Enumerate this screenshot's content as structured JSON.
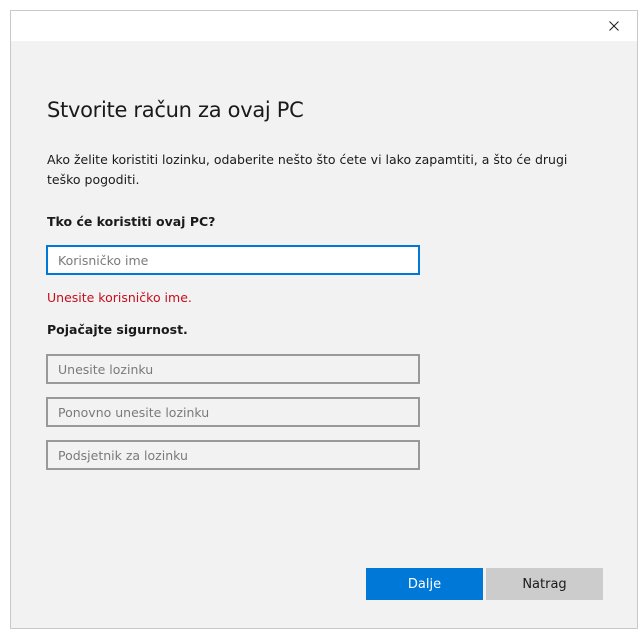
{
  "dialog": {
    "heading": "Stvorite račun za ovaj PC",
    "description": "Ako želite koristiti lozinku, odaberite nešto što ćete vi lako zapamtiti, a što će drugi teško pogoditi.",
    "close_icon": "close-icon"
  },
  "who_section": {
    "label": "Tko će koristiti ovaj PC?",
    "username": {
      "value": "",
      "placeholder": "Korisničko ime"
    },
    "error": "Unesite korisničko ime."
  },
  "security_section": {
    "label": "Pojačajte sigurnost.",
    "password": {
      "value": "",
      "placeholder": "Unesite lozinku"
    },
    "repeat_password": {
      "value": "",
      "placeholder": "Ponovno unesite lozinku"
    },
    "hint": {
      "value": "",
      "placeholder": "Podsjetnik za lozinku"
    }
  },
  "buttons": {
    "next_label": "Dalje",
    "back_label": "Natrag"
  },
  "colors": {
    "accent": "#0078d7",
    "error": "#c50f1f",
    "dialog_background": "#f2f2f2",
    "secondary_button": "#cccccc"
  }
}
